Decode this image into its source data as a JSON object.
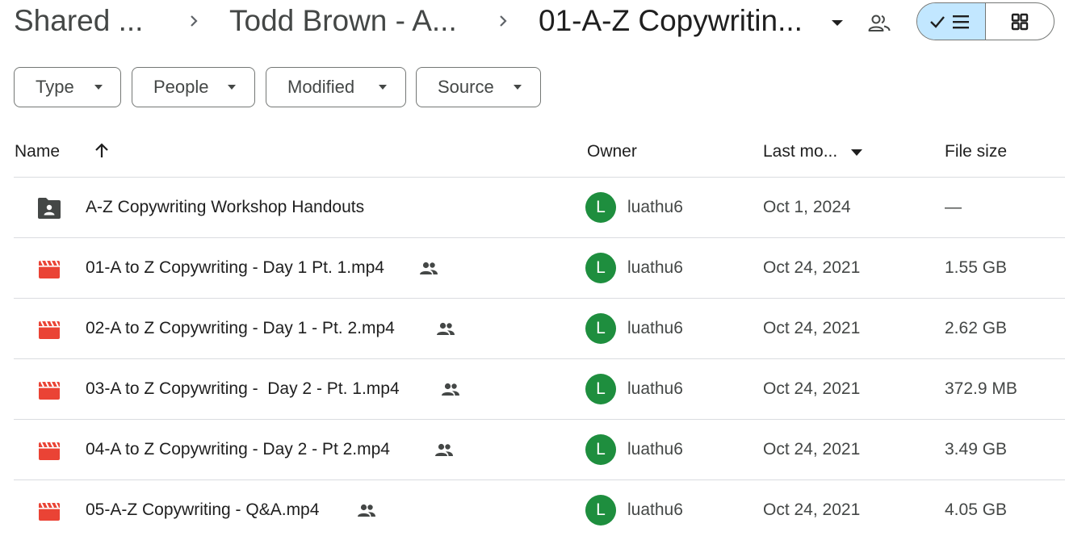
{
  "breadcrumb": {
    "items": [
      {
        "label": "Shared ..."
      },
      {
        "label": "Todd Brown - A..."
      },
      {
        "label": "01-A-Z Copywritin..."
      }
    ]
  },
  "view_toggle": {
    "active": "list"
  },
  "filters": [
    {
      "label": "Type"
    },
    {
      "label": "People"
    },
    {
      "label": "Modified"
    },
    {
      "label": "Source"
    }
  ],
  "columns": {
    "name": "Name",
    "owner": "Owner",
    "modified": "Last mo...",
    "size": "File size"
  },
  "files": [
    {
      "name": "A-Z Copywriting Workshop Handouts",
      "type": "shared-folder",
      "shared": false,
      "owner_initial": "L",
      "owner": "luathu6",
      "modified": "Oct 1, 2024",
      "size": "—"
    },
    {
      "name": "01-A to Z Copywriting - Day 1 Pt. 1.mp4",
      "type": "video",
      "shared": true,
      "owner_initial": "L",
      "owner": "luathu6",
      "modified": "Oct 24, 2021",
      "size": "1.55 GB"
    },
    {
      "name": "02-A to Z Copywriting - Day 1 - Pt. 2.mp4",
      "type": "video",
      "shared": true,
      "owner_initial": "L",
      "owner": "luathu6",
      "modified": "Oct 24, 2021",
      "size": "2.62 GB"
    },
    {
      "name": "03-A to Z Copywriting -  Day 2 - Pt. 1.mp4",
      "type": "video",
      "shared": true,
      "owner_initial": "L",
      "owner": "luathu6",
      "modified": "Oct 24, 2021",
      "size": "372.9 MB"
    },
    {
      "name": "04-A to Z Copywriting - Day 2 - Pt 2.mp4",
      "type": "video",
      "shared": true,
      "owner_initial": "L",
      "owner": "luathu6",
      "modified": "Oct 24, 2021",
      "size": "3.49 GB"
    },
    {
      "name": "05-A-Z Copywriting - Q&A.mp4",
      "type": "video",
      "shared": true,
      "owner_initial": "L",
      "owner": "luathu6",
      "modified": "Oct 24, 2021",
      "size": "4.05 GB"
    }
  ],
  "colors": {
    "accent_selected": "#c2e7ff",
    "video_icon": "#ea4335",
    "folder_icon": "#444746",
    "avatar_bg": "#1e8e3e",
    "divider": "#dadce0"
  },
  "icons": {
    "breadcrumb_separator": "chevron-right-icon",
    "breadcrumb_menu": "arrow-drop-down-icon",
    "share": "people-outline-icon",
    "list_view": "check-list-icon",
    "grid_view": "grid-icon",
    "sort": "arrow-up-icon",
    "shared_file": "people-icon",
    "video_file": "video-file-icon",
    "shared_folder": "shared-folder-icon"
  }
}
